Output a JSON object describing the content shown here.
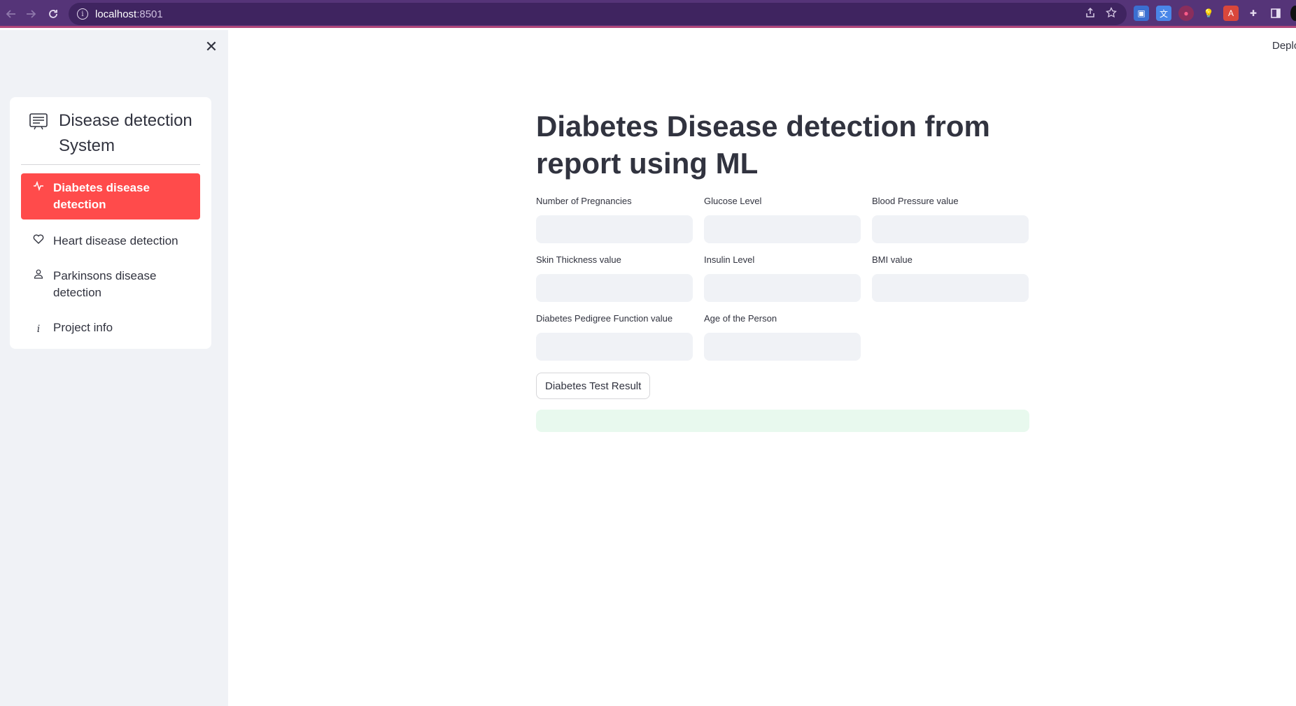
{
  "browser": {
    "url_host": "localhost",
    "url_port": ":8501"
  },
  "sidebar": {
    "close_symbol": "✕",
    "menu_title": "Disease detection System",
    "items": [
      {
        "icon": "activity-icon",
        "label": "Diabetes disease detection",
        "active": true
      },
      {
        "icon": "heart-icon",
        "label": "Heart disease detection",
        "active": false
      },
      {
        "icon": "person-icon",
        "label": "Parkinsons disease detection",
        "active": false
      },
      {
        "icon": "info-icon",
        "label": "Project info",
        "active": false
      }
    ]
  },
  "header": {
    "deploy_label": "Deploy"
  },
  "main": {
    "title": "Diabetes Disease detection from report using ML",
    "fields": [
      {
        "label": "Number of Pregnancies",
        "value": ""
      },
      {
        "label": "Glucose Level",
        "value": ""
      },
      {
        "label": "Blood Pressure value",
        "value": ""
      },
      {
        "label": "Skin Thickness value",
        "value": ""
      },
      {
        "label": "Insulin Level",
        "value": ""
      },
      {
        "label": "BMI value",
        "value": ""
      },
      {
        "label": "Diabetes Pedigree Function value",
        "value": ""
      },
      {
        "label": "Age of the Person",
        "value": ""
      }
    ],
    "button_label": "Diabetes Test Result",
    "result_text": ""
  },
  "colors": {
    "browser_bar": "#553478",
    "accent": "#ff4b4b",
    "sidebar_bg": "#f0f2f6",
    "input_bg": "#f0f2f6",
    "success_bg": "#e8f9ee"
  }
}
